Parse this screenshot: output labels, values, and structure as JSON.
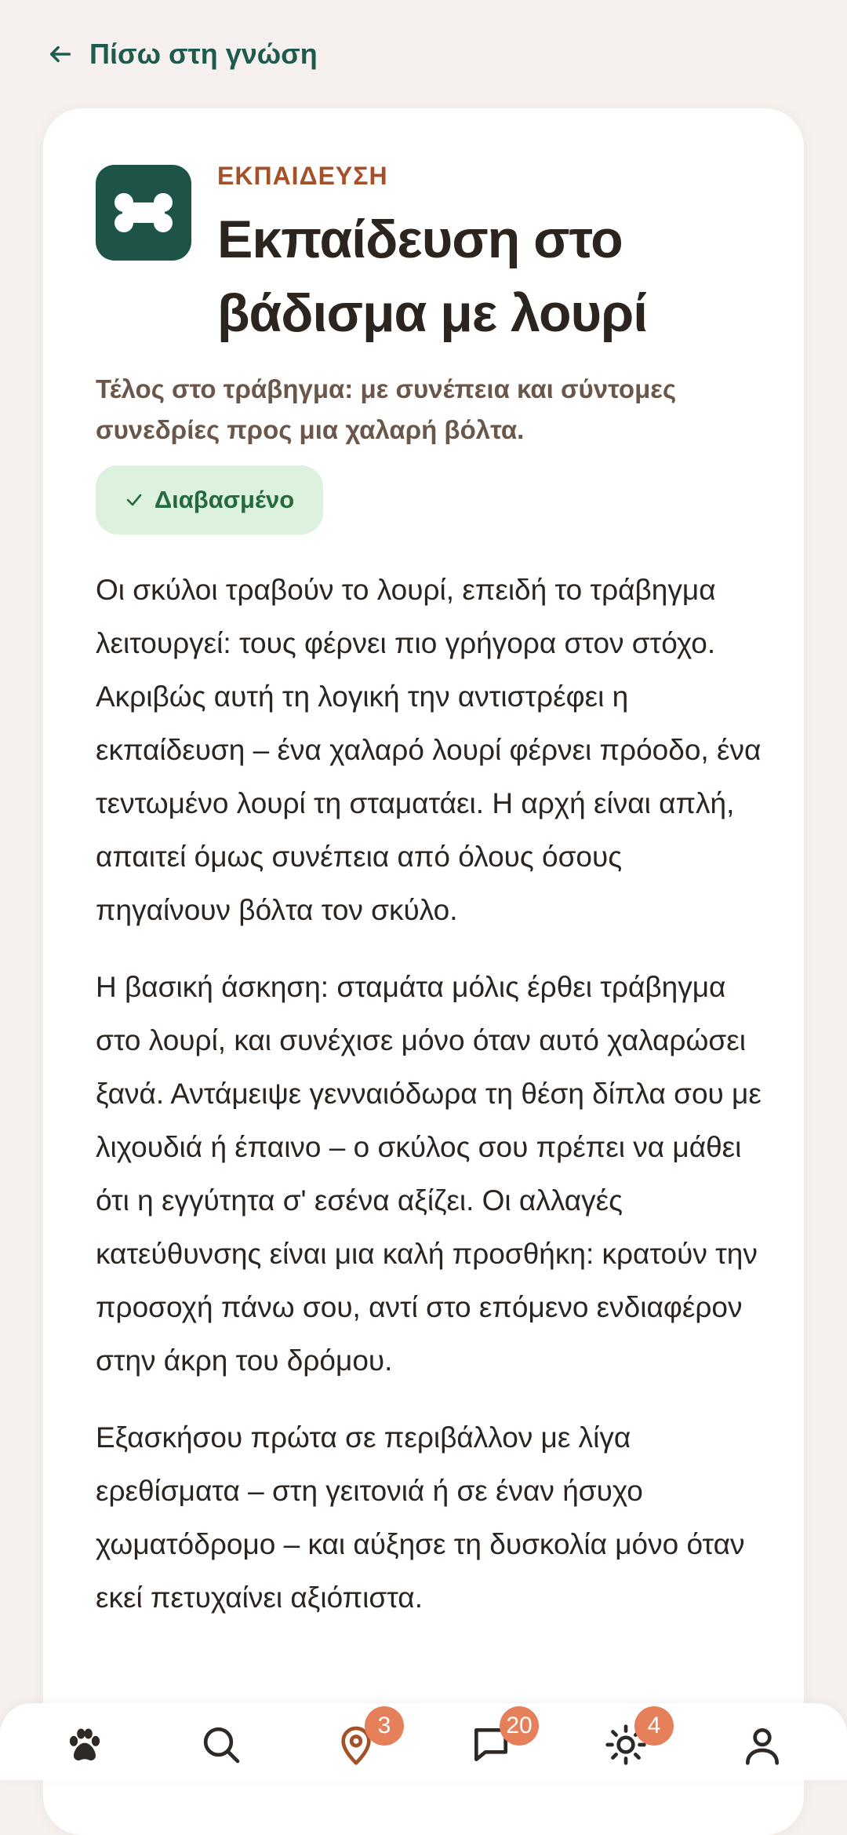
{
  "header": {
    "back_label": "Πίσω στη γνώση"
  },
  "article": {
    "category": "ΕΚΠΑΙΔΕΥΣΗ",
    "category_icon": "bone-icon",
    "title": "Εκπαίδευση στο βάδισμα με λουρί",
    "subtitle": "Τέλος στο τράβηγμα: με συνέπεια και σύντομες συνεδρίες προς μια χαλαρή βόλτα.",
    "read_badge": "Διαβασμένο",
    "paragraphs": [
      "Οι σκύλοι τραβούν το λουρί, επειδή το τράβηγμα λειτουργεί: τους φέρνει πιο γρήγορα στον στόχο. Ακριβώς αυτή τη λογική την αντιστρέφει η εκπαίδευση – ένα χαλαρό λουρί φέρνει πρόοδο, ένα τεντωμένο λουρί τη σταματάει. Η αρχή είναι απλή, απαιτεί όμως συνέπεια από όλους όσους πηγαίνουν βόλτα τον σκύλο.",
      "Η βασική άσκηση: σταμάτα μόλις έρθει τράβηγμα στο λουρί, και συνέχισε μόνο όταν αυτό χαλαρώσει ξανά. Αντάμειψε γενναιόδωρα τη θέση δίπλα σου με λιχουδιά ή έπαινο – ο σκύλος σου πρέπει να μάθει ότι η εγγύτητα σ' εσένα αξίζει. Οι αλλαγές κατεύθυνσης είναι μια καλή προσθήκη: κρατούν την προσοχή πάνω σου, αντί στο επόμενο ενδιαφέρον στην άκρη του δρόμου.",
      "Εξασκήσου πρώτα σε περιβάλλον με λίγα ερεθίσματα – στη γειτονιά ή σε έναν ήσυχο χωματόδρομο – και αύξησε τη δυσκολία μόνο όταν εκεί πετυχαίνει αξιόπιστα."
    ]
  },
  "nav": {
    "items": [
      {
        "icon": "paw-icon",
        "badge": null
      },
      {
        "icon": "search-icon",
        "badge": null
      },
      {
        "icon": "map-pin-icon",
        "badge": "3"
      },
      {
        "icon": "chat-icon",
        "badge": "20"
      },
      {
        "icon": "sun-icon",
        "badge": "4"
      },
      {
        "icon": "user-icon",
        "badge": null
      }
    ]
  },
  "colors": {
    "accent_green": "#1d5447",
    "category_brown": "#a4512a",
    "badge_bg": "#ddf1df",
    "notification": "#e5805b",
    "background": "#f6f1ee"
  }
}
